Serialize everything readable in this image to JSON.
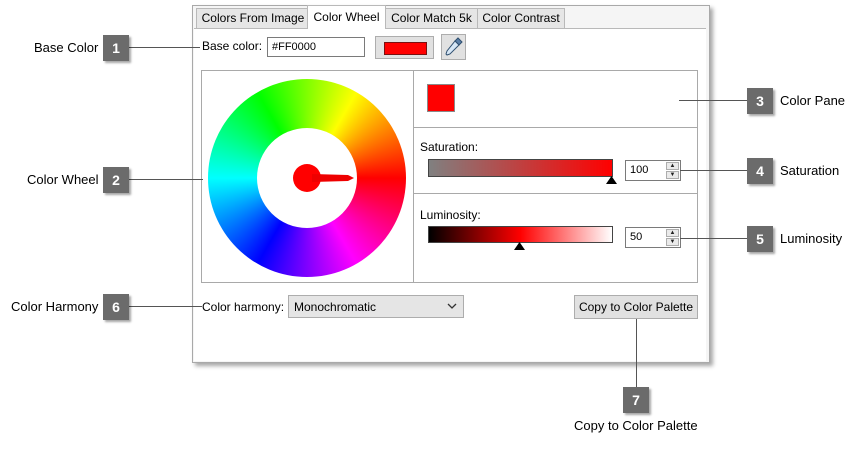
{
  "tabs": [
    "Colors From Image",
    "Color Wheel",
    "Color Match 5k",
    "Color Contrast"
  ],
  "active_tab": "Color Wheel",
  "base_color": {
    "label": "Base color:",
    "value": "#FF0000",
    "swatch": "#ff0000"
  },
  "saturation": {
    "label": "Saturation:",
    "value": "100"
  },
  "luminosity": {
    "label": "Luminosity:",
    "value": "50"
  },
  "harmony": {
    "label": "Color harmony:",
    "selected": "Monochromatic"
  },
  "copy_button": "Copy to Color Palette",
  "callouts": [
    {
      "num": "1",
      "text": "Base Color"
    },
    {
      "num": "2",
      "text": "Color Wheel"
    },
    {
      "num": "3",
      "text": "Color Pane"
    },
    {
      "num": "4",
      "text": "Saturation"
    },
    {
      "num": "5",
      "text": "Luminosity"
    },
    {
      "num": "6",
      "text": "Color Harmony"
    },
    {
      "num": "7",
      "text": "Copy to Color Palette"
    }
  ],
  "icons": [
    "eyedropper-icon",
    "wheel-handle-icon",
    "triangle-marker-icon",
    "spin-up-icon",
    "spin-down-icon",
    "chevron-down-icon"
  ]
}
